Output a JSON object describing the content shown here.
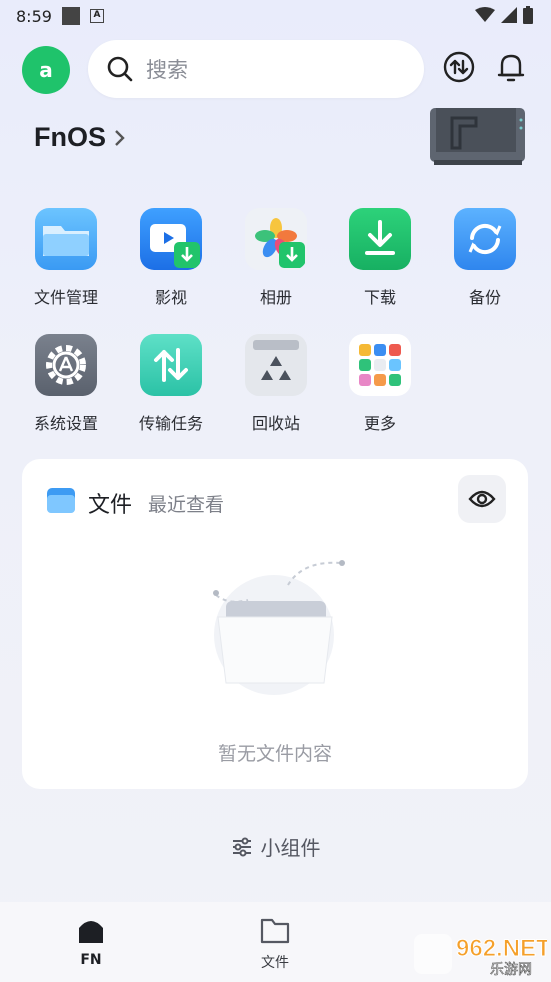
{
  "status_bar": {
    "time": "8:59"
  },
  "header": {
    "avatar_letter": "a",
    "search_placeholder": "搜索",
    "device_name": "FnOS"
  },
  "apps": [
    {
      "label": "文件管理",
      "icon": "folder-icon"
    },
    {
      "label": "影视",
      "icon": "video-icon"
    },
    {
      "label": "相册",
      "icon": "photos-icon"
    },
    {
      "label": "下载",
      "icon": "download-icon"
    },
    {
      "label": "备份",
      "icon": "backup-icon"
    },
    {
      "label": "系统设置",
      "icon": "settings-icon"
    },
    {
      "label": "传输任务",
      "icon": "transfer-icon"
    },
    {
      "label": "回收站",
      "icon": "recycle-icon"
    },
    {
      "label": "更多",
      "icon": "more-apps-icon"
    }
  ],
  "files_card": {
    "title": "文件",
    "subtitle": "最近查看",
    "empty_text": "暂无文件内容"
  },
  "widgets_label": "小组件",
  "bottom_nav": [
    {
      "label": "FN",
      "active": true
    },
    {
      "label": "文件",
      "active": false
    }
  ],
  "watermark": {
    "text": "962.NET",
    "subtext": "乐游网"
  },
  "colors": {
    "accent": "#1fc36b",
    "background": "#eceefa"
  }
}
